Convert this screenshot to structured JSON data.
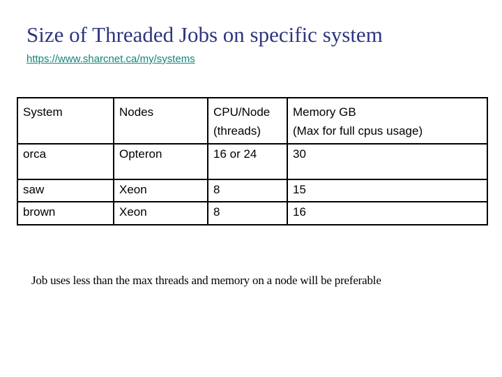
{
  "slide": {
    "title": "Size of Threaded Jobs on specific system",
    "link": "https://www.sharcnet.ca/my/systems",
    "table": {
      "headers": [
        {
          "line1": "System",
          "line2": ""
        },
        {
          "line1": "Nodes",
          "line2": ""
        },
        {
          "line1": "CPU/Node",
          "line2": "(threads)"
        },
        {
          "line1": "Memory GB",
          "line2": "(Max for full cpus usage)"
        }
      ],
      "rows": [
        [
          "orca",
          "Opteron",
          "16 or 24",
          "30"
        ],
        [
          "saw",
          "Xeon",
          "8",
          "15"
        ],
        [
          "brown",
          "Xeon",
          "8",
          "16"
        ]
      ]
    },
    "note": "Job uses less than the max threads and memory on a node will be preferable"
  }
}
